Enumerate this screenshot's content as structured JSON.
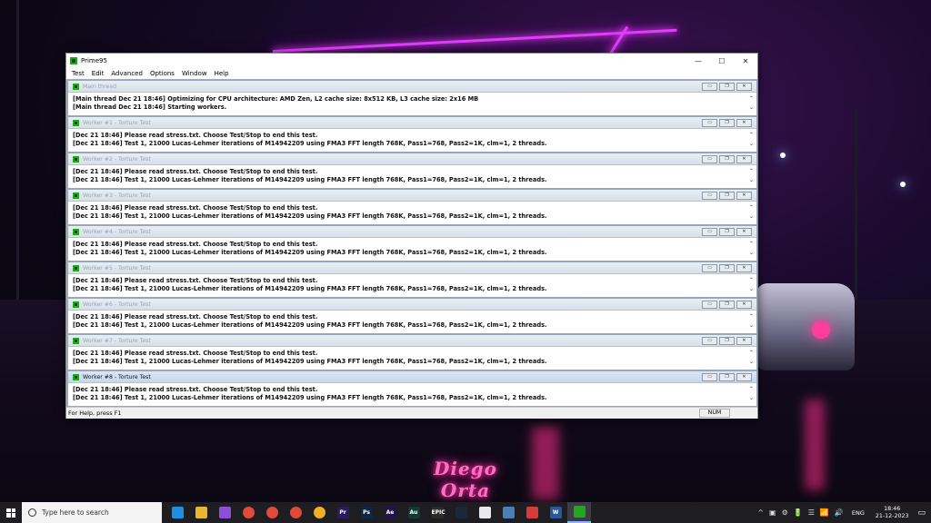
{
  "window": {
    "title": "Prime95",
    "menu": [
      "Test",
      "Edit",
      "Advanced",
      "Options",
      "Window",
      "Help"
    ],
    "minimize": "—",
    "maximize": "☐",
    "close": "✕"
  },
  "children": [
    {
      "title": "Main thread",
      "lines": [
        "[Main thread Dec 21 18:46] Optimizing for CPU architecture: AMD Zen, L2 cache size: 8x512 KB, L3 cache size: 2x16 MB",
        "[Main thread Dec 21 18:46] Starting workers."
      ]
    },
    {
      "title": "Worker #1 - Torture Test",
      "lines": [
        "[Dec 21 18:46] Please read stress.txt.  Choose Test/Stop to end this test.",
        "[Dec 21 18:46] Test 1, 21000 Lucas-Lehmer iterations of M14942209 using FMA3 FFT length 768K, Pass1=768, Pass2=1K, clm=1, 2 threads."
      ]
    },
    {
      "title": "Worker #2 - Torture Test",
      "lines": [
        "[Dec 21 18:46] Please read stress.txt.  Choose Test/Stop to end this test.",
        "[Dec 21 18:46] Test 1, 21000 Lucas-Lehmer iterations of M14942209 using FMA3 FFT length 768K, Pass1=768, Pass2=1K, clm=1, 2 threads."
      ]
    },
    {
      "title": "Worker #3 - Torture Test",
      "lines": [
        "[Dec 21 18:46] Please read stress.txt.  Choose Test/Stop to end this test.",
        "[Dec 21 18:46] Test 1, 21000 Lucas-Lehmer iterations of M14942209 using FMA3 FFT length 768K, Pass1=768, Pass2=1K, clm=1, 2 threads."
      ]
    },
    {
      "title": "Worker #4 - Torture Test",
      "lines": [
        "[Dec 21 18:46] Please read stress.txt.  Choose Test/Stop to end this test.",
        "[Dec 21 18:46] Test 1, 21000 Lucas-Lehmer iterations of M14942209 using FMA3 FFT length 768K, Pass1=768, Pass2=1K, clm=1, 2 threads."
      ]
    },
    {
      "title": "Worker #5 - Torture Test",
      "lines": [
        "[Dec 21 18:46] Please read stress.txt.  Choose Test/Stop to end this test.",
        "[Dec 21 18:46] Test 1, 21000 Lucas-Lehmer iterations of M14942209 using FMA3 FFT length 768K, Pass1=768, Pass2=1K, clm=1, 2 threads."
      ]
    },
    {
      "title": "Worker #6 - Torture Test",
      "lines": [
        "[Dec 21 18:46] Please read stress.txt.  Choose Test/Stop to end this test.",
        "[Dec 21 18:46] Test 1, 21000 Lucas-Lehmer iterations of M14942209 using FMA3 FFT length 768K, Pass1=768, Pass2=1K, clm=1, 2 threads."
      ]
    },
    {
      "title": "Worker #7 - Torture Test",
      "lines": [
        "[Dec 21 18:46] Please read stress.txt.  Choose Test/Stop to end this test.",
        "[Dec 21 18:46] Test 1, 21000 Lucas-Lehmer iterations of M14942209 using FMA3 FFT length 768K, Pass1=768, Pass2=1K, clm=1, 2 threads."
      ]
    },
    {
      "title": "Worker #8 - Torture Test",
      "lines": [
        "[Dec 21 18:46] Please read stress.txt.  Choose Test/Stop to end this test.",
        "[Dec 21 18:46] Test 1, 21000 Lucas-Lehmer iterations of M14942209 using FMA3 FFT length 768K, Pass1=768, Pass2=1K, clm=1, 2 threads."
      ]
    }
  ],
  "child_buttons": {
    "minimize": "▭",
    "restore": "❐",
    "close": "✕"
  },
  "status": {
    "help": "For Help, press F1",
    "num": "NUM"
  },
  "wallpaper": {
    "signature": "Diego Orta"
  },
  "taskbar": {
    "search_placeholder": "Type here to search",
    "apps": [
      {
        "name": "edge-icon",
        "color": "#1f8fe0",
        "label": ""
      },
      {
        "name": "file-explorer-icon",
        "color": "#e8b730",
        "label": ""
      },
      {
        "name": "visual-studio-icon",
        "color": "#8d4fd6",
        "label": ""
      },
      {
        "name": "chrome-icon",
        "color": "#e04a3a",
        "label": ""
      },
      {
        "name": "chrome-icon",
        "color": "#e04a3a",
        "label": ""
      },
      {
        "name": "chrome-icon",
        "color": "#e04a3a",
        "label": ""
      },
      {
        "name": "chrome-canary-icon",
        "color": "#f2b021",
        "label": ""
      },
      {
        "name": "premiere-pro-icon",
        "color": "#2a1b5c",
        "label": "Pr"
      },
      {
        "name": "photoshop-icon",
        "color": "#0a2744",
        "label": "Ps"
      },
      {
        "name": "after-effects-icon",
        "color": "#20144a",
        "label": "Ae"
      },
      {
        "name": "audition-icon",
        "color": "#0f3b33",
        "label": "Au"
      },
      {
        "name": "epic-games-icon",
        "color": "#2b2b2b",
        "label": "EPIC"
      },
      {
        "name": "steam-icon",
        "color": "#1b2838",
        "label": ""
      },
      {
        "name": "notepad-icon",
        "color": "#e9e9e9",
        "label": ""
      },
      {
        "name": "photos-icon",
        "color": "#4a7fb5",
        "label": ""
      },
      {
        "name": "screen-recorder-icon",
        "color": "#d53b3b",
        "label": ""
      },
      {
        "name": "word-icon",
        "color": "#2b579a",
        "label": "W"
      },
      {
        "name": "prime95-icon",
        "color": "#1ea81e",
        "label": ""
      }
    ],
    "tray_icons": [
      "^",
      "▣",
      "⚙",
      "🔋",
      "☰",
      "📶",
      "🔊"
    ],
    "language": "ENG",
    "time": "18:46",
    "date": "21-12-2023",
    "notification": "▭"
  }
}
